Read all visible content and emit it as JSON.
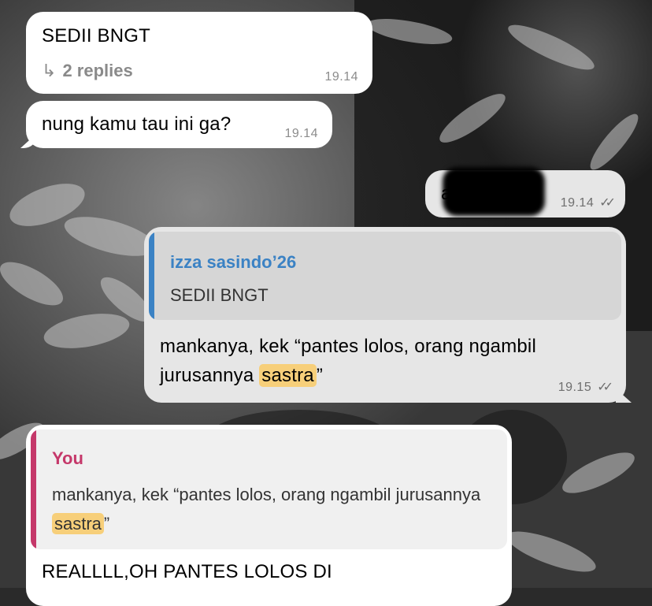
{
  "colors": {
    "incoming_bubble": "#ffffff",
    "outgoing_bubble": "#e6e6e6",
    "quote_you_accent": "#c5386a",
    "quote_other_accent": "#3b82c4",
    "highlight": "#f7cf7a"
  },
  "messages": [
    {
      "direction": "incoming",
      "text": "SEDII BNGT",
      "replies_label": "2 replies",
      "time": "19.14"
    },
    {
      "direction": "incoming",
      "text": "nung kamu tau ini ga?",
      "time": "19.14"
    },
    {
      "direction": "outgoing",
      "text": "a?",
      "redacted": true,
      "time": "19.14",
      "status_icon": "double-check-icon"
    },
    {
      "direction": "outgoing",
      "quote": {
        "author": "izza sasindo’26",
        "text": "SEDII BNGT"
      },
      "text_before": "mankanya, kek “pantes lolos, orang ngambil jurusannya ",
      "text_highlight": "sastra",
      "text_after": "”",
      "time": "19.15",
      "status_icon": "double-check-icon"
    },
    {
      "direction": "incoming",
      "quote": {
        "author": "You",
        "text_before": "mankanya, kek “pantes lolos, orang ngambil jurusannya ",
        "text_highlight": "sastra",
        "text_after": "”"
      },
      "text": "REALLLL,OH PANTES LOLOS DI"
    }
  ]
}
